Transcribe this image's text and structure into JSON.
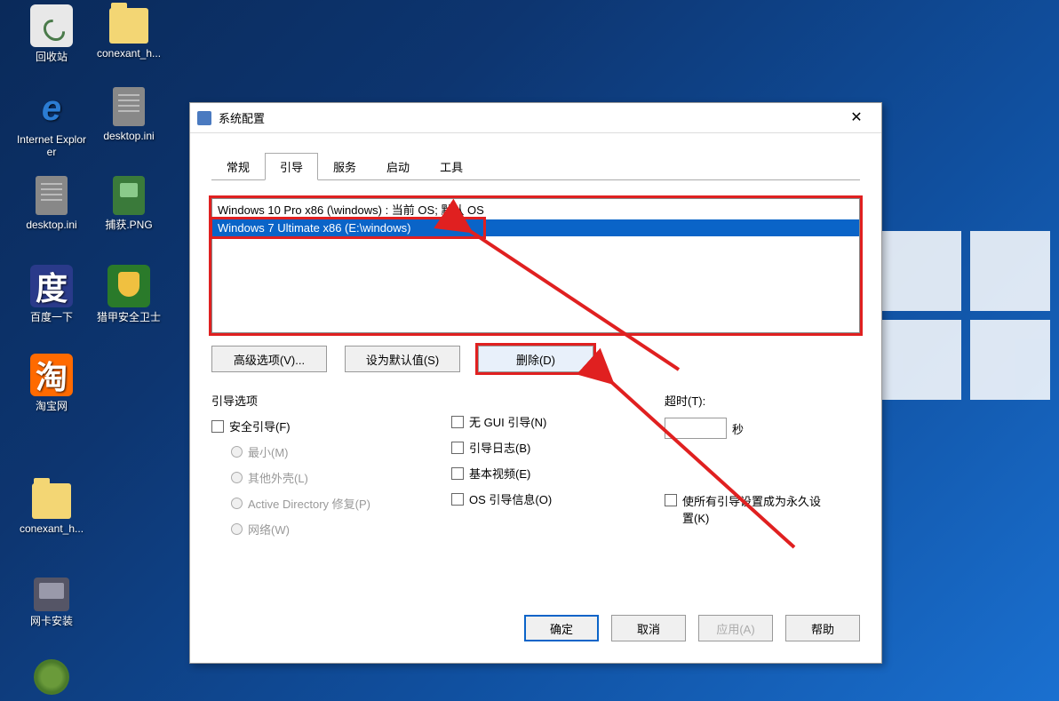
{
  "desktop": {
    "icons": [
      {
        "label": "回收站",
        "kind": "recycle"
      },
      {
        "label": "conexant_h...",
        "kind": "folder"
      },
      {
        "label": "Internet Explorer",
        "kind": "ie"
      },
      {
        "label": "desktop.ini",
        "kind": "ini"
      },
      {
        "label": "desktop.ini",
        "kind": "ini"
      },
      {
        "label": "捕获.PNG",
        "kind": "png"
      },
      {
        "label": "百度一下",
        "kind": "baidu",
        "glyph": "度"
      },
      {
        "label": "猎甲安全卫士",
        "kind": "shield"
      },
      {
        "label": "淘宝网",
        "kind": "taobao",
        "glyph": "淘"
      },
      {
        "label": "conexant_h...",
        "kind": "folder"
      },
      {
        "label": "网卡安装",
        "kind": "net"
      },
      {
        "label": "",
        "kind": "globe"
      }
    ]
  },
  "dialog": {
    "title": "系统配置",
    "tabs": [
      "常规",
      "引导",
      "服务",
      "启动",
      "工具"
    ],
    "active_tab": "引导",
    "boot_list": [
      "Windows 10 Pro x86 (\\windows) : 当前 OS; 默认 OS",
      "Windows 7 Ultimate x86 (E:\\windows)"
    ],
    "selected_index": 1,
    "buttons": {
      "advanced": "高级选项(V)...",
      "set_default": "设为默认值(S)",
      "delete": "删除(D)"
    },
    "boot_options": {
      "group_label": "引导选项",
      "safe_boot": "安全引导(F)",
      "radios": [
        "最小(M)",
        "其他外壳(L)",
        "Active Directory 修复(P)",
        "网络(W)"
      ],
      "no_gui": "无 GUI 引导(N)",
      "boot_log": "引导日志(B)",
      "basic_video": "基本视频(E)",
      "os_boot_info": "OS 引导信息(O)"
    },
    "timeout": {
      "label": "超时(T):",
      "value": "",
      "unit": "秒"
    },
    "permanent": "使所有引导设置成为永久设置(K)",
    "dlg_buttons": {
      "ok": "确定",
      "cancel": "取消",
      "apply": "应用(A)",
      "help": "帮助"
    }
  }
}
